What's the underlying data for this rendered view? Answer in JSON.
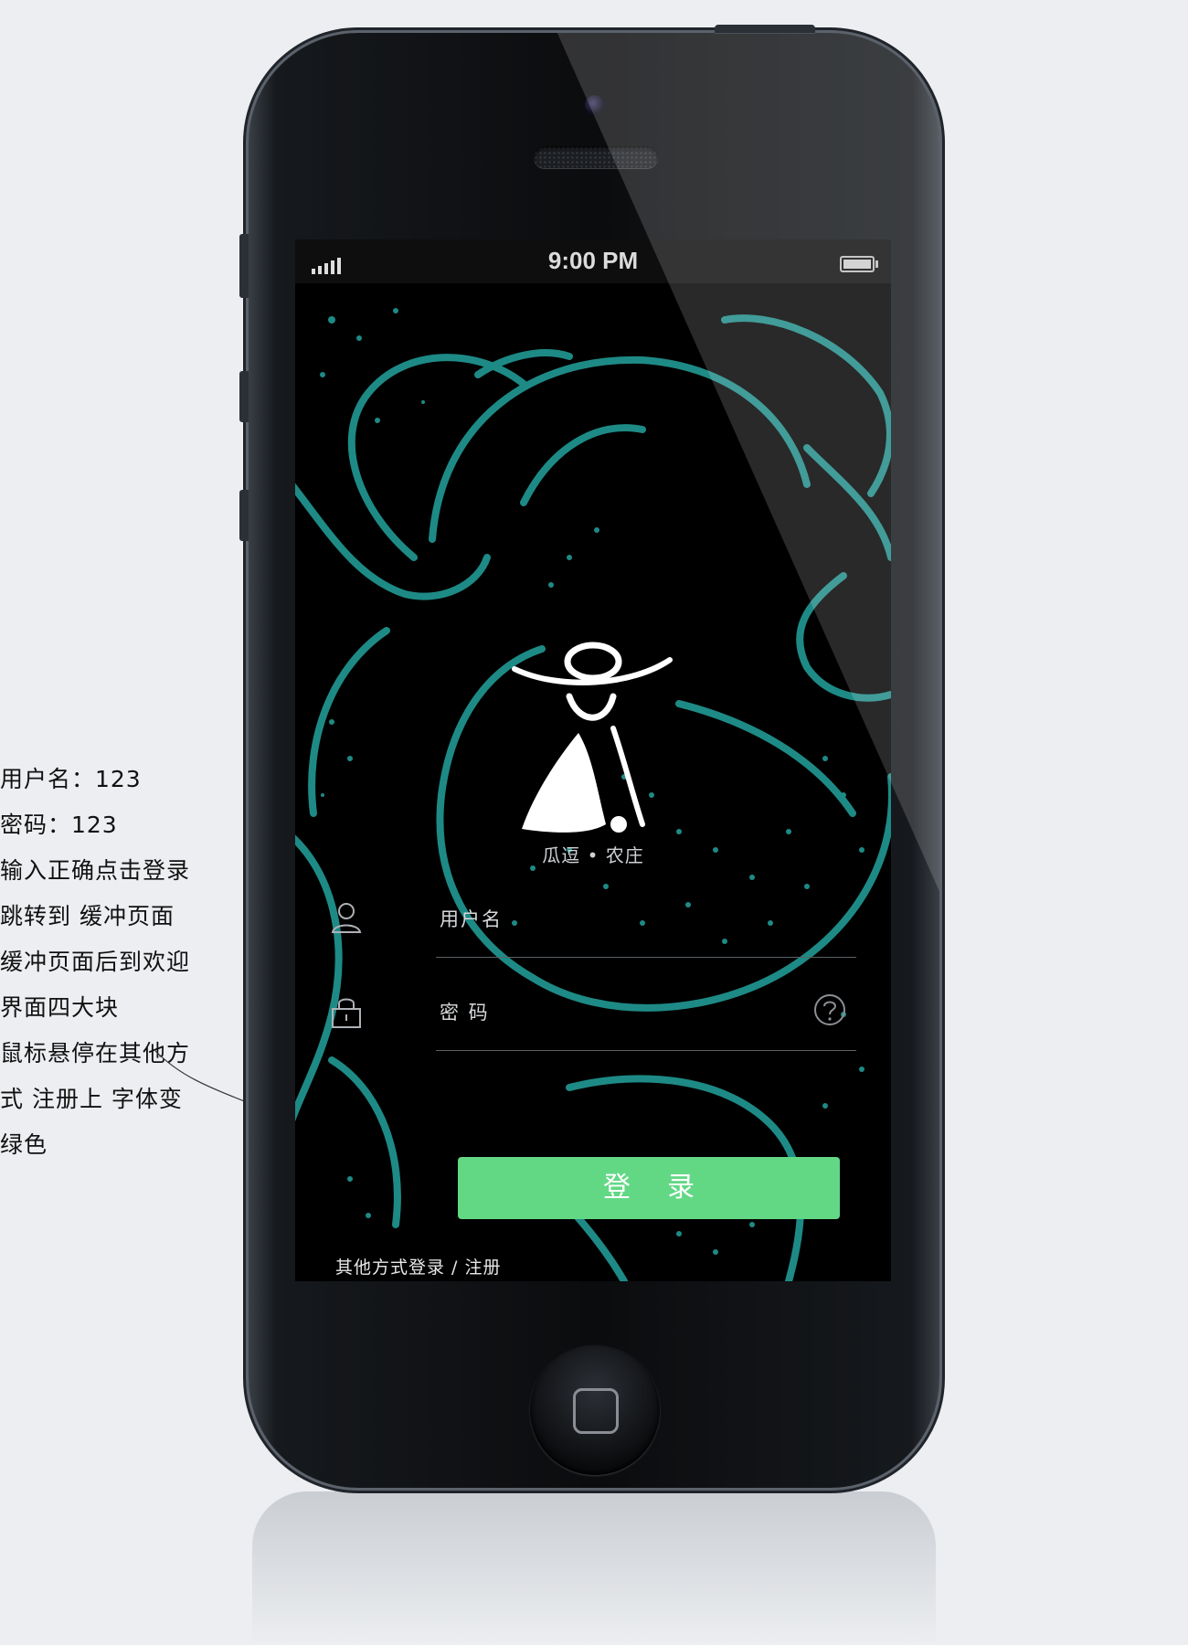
{
  "annotations": [
    "用户名：123",
    "密码：123",
    " 输入正确点击登录",
    "跳转到  缓冲页面",
    "缓冲页面后到欢迎",
    "界面四大块",
    "  鼠标悬停在其他方",
    "式  注册上  字体变",
    "绿色"
  ],
  "status_bar": {
    "time": "9:00 PM",
    "signal_icon": "signal-icon",
    "battery_icon": "battery-icon"
  },
  "app": {
    "brand": "瓜逗 • 农庄",
    "username_label": "用户名",
    "password_label": "密  码",
    "login_button": "登录",
    "other_login": "其他方式登录 / 注册",
    "accent_color": "#62d885",
    "art_color": "#1e8a86"
  }
}
